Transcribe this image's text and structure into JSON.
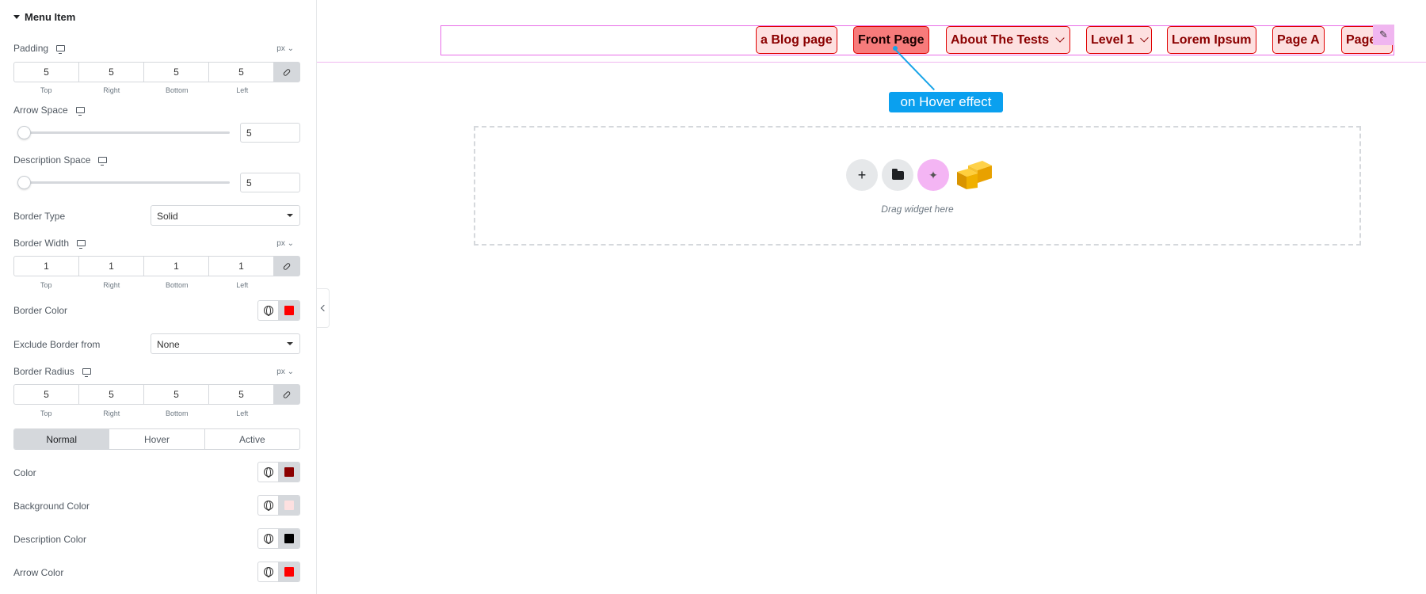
{
  "panel": {
    "section_title": "Menu Item",
    "padding": {
      "label": "Padding",
      "unit": "px",
      "top": "5",
      "right": "5",
      "bottom": "5",
      "left": "5"
    },
    "dim_labels": {
      "top": "Top",
      "right": "Right",
      "bottom": "Bottom",
      "left": "Left"
    },
    "arrow_space": {
      "label": "Arrow Space",
      "value": "5"
    },
    "description_space": {
      "label": "Description Space",
      "value": "5"
    },
    "border_type": {
      "label": "Border Type",
      "value": "Solid"
    },
    "border_width": {
      "label": "Border Width",
      "unit": "px",
      "top": "1",
      "right": "1",
      "bottom": "1",
      "left": "1"
    },
    "border_color": {
      "label": "Border Color",
      "color": "#ff0000"
    },
    "exclude_border": {
      "label": "Exclude Border from",
      "value": "None"
    },
    "border_radius": {
      "label": "Border Radius",
      "unit": "px",
      "top": "5",
      "right": "5",
      "bottom": "5",
      "left": "5"
    },
    "state_tabs": [
      "Normal",
      "Hover",
      "Active"
    ],
    "color": {
      "label": "Color",
      "color": "#8b0000"
    },
    "background_color": {
      "label": "Background Color",
      "color": "#fde0e0"
    },
    "description_color": {
      "label": "Description Color",
      "color": "#000000"
    },
    "arrow_color": {
      "label": "Arrow Color",
      "color": "#ff0000"
    }
  },
  "canvas": {
    "menu_items": [
      {
        "label": "a Blog page",
        "has_arrow": false
      },
      {
        "label": "Front Page",
        "has_arrow": false,
        "hovered": true
      },
      {
        "label": "About The Tests",
        "has_arrow": true
      },
      {
        "label": "Level 1",
        "has_arrow": true
      },
      {
        "label": "Lorem Ipsum",
        "has_arrow": false
      },
      {
        "label": "Page A",
        "has_arrow": false
      },
      {
        "label": "Page",
        "has_arrow": false
      }
    ],
    "callout": "on Hover effect",
    "dropzone_text": "Drag widget here"
  }
}
